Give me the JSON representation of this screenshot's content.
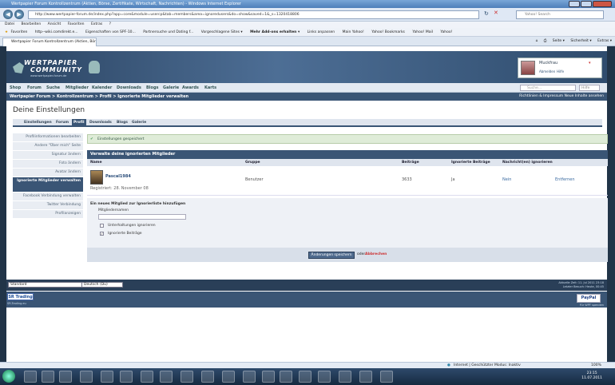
{
  "window": {
    "title": "Wertpapier Forum Kontrollzentrum (Aktien, Börse, Zertifikate, Wirtschaft, Nachrichten) - Windows Internet Explorer"
  },
  "browser": {
    "url": "http://www.wertpapier-forum.de/index.php?app=core&module=usercp&tab=members&area=ignoredusers&do=show&saved=1&_s=1320418806",
    "search_placeholder": "Yahoo! Search",
    "menu": [
      "Datei",
      "Bearbeiten",
      "Ansicht",
      "Favoriten",
      "Extras",
      "?"
    ],
    "favorites": [
      "Favoriten",
      "http--wiki.comdirekt.e...",
      "Eigenschaften von SPF-10...",
      "Partnersuche und Dating f...",
      "Vorgeschlagene Sites ▾",
      "Mehr Add-ons erhalten ▾",
      "Links anpassen",
      "Main Yahoo!",
      "Yahoo! Bookmarks",
      "Yahoo! Mail",
      "Yahoo!"
    ],
    "tab": "Wertpapier Forum Kontrollzentrum (Aktien, Börs...",
    "tools": [
      "Seite ▾",
      "Sicherheit ▾",
      "Extras ▾"
    ],
    "status": "Internet | Geschützter Modus: Inaktiv",
    "zoom": "100%"
  },
  "site": {
    "logo_line1": "WERTPAPIER",
    "logo_line2": "COMMUNITY",
    "logo_line3": "www.wertpapier-forum.de",
    "user": "Muckfrau",
    "user_links": [
      "Abmelden",
      "Hilfe"
    ],
    "nav": [
      "Shop",
      "Forum",
      "Suche",
      "Mitglieder",
      "Kalender",
      "Downloads",
      "Blogs",
      "Galerie",
      "Awards",
      "Karts"
    ],
    "search_placeholder": "Suche...",
    "search_scope": "Hilfe",
    "breadcrumb": "Wertpapier Forum  >  Kontrollzentrum  >  Profil  >  Ignorierte Mitglieder verwalten",
    "crumb_right": "Richtlinien & Impressum   Neue Inhalte ansehen"
  },
  "page": {
    "title": "Deine Einstellungen",
    "tabs": [
      "Einstellungen",
      "Forum",
      "Profil",
      "Downloads",
      "Blogs",
      "Galerie"
    ],
    "active_tab": "Profil",
    "sidebar": [
      "Profilinformationen bearbeiten",
      "Andere \"Über mich\" Seite",
      "Signatur ändern",
      "Foto ändern",
      "Avatar ändern",
      "Ignorierte Mitglieder verwalten",
      "Facebook Verbindung verwalten",
      "Twitter Verbindung",
      "Profilanzeigen"
    ],
    "notice": "Einstellungen gespeichert",
    "section_title": "Verwalte deine ignorierten Mitglieder",
    "columns": [
      "Name",
      "Gruppe",
      "Beiträge",
      "Ignorierte Beiträge",
      "Nachricht(en) ignorieren"
    ],
    "member": {
      "name": "Pascal1984",
      "registered": "Registriert: 28. November 08",
      "group": "Benutzer",
      "posts": "3633",
      "ignore_posts": "Ja",
      "ignore_msgs": "Nein",
      "action": "Entfernen"
    },
    "add_title": "Ein neues Mitglied zur Ignorierliste hinzufügen",
    "name_label": "Mitgliedernamen",
    "opt1": "Unterhaltungen ignorieren",
    "opt2": "Ignorierte Beiträge",
    "save": "Änderungen speichern",
    "or": "oder",
    "cancel": "Abbrechen"
  },
  "footer": {
    "skin": "Standard",
    "lang": "Deutsch (Du)",
    "time": "Aktuelle Zeit: 11. Jul 2011 23:18",
    "last": "Letzter Besuch: Heute, 00:45",
    "sr": "SR Trading",
    "sr_sub": "SR-Trading.eu",
    "paypal": "PayPal",
    "paypal_sub": "Für WPF spenden"
  },
  "taskbar": {
    "time": "23:15",
    "date": "11.07.2011"
  }
}
